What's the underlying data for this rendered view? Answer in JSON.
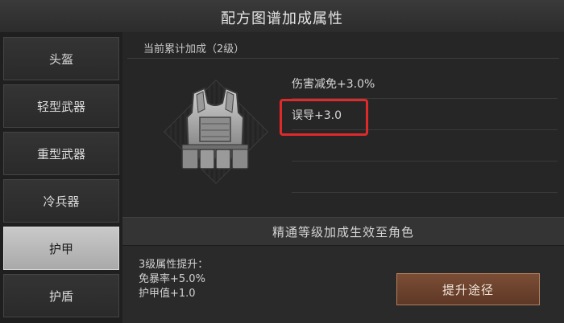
{
  "window": {
    "title": "配方图谱加成属性"
  },
  "sidebar": {
    "items": [
      {
        "label": "头盔"
      },
      {
        "label": "轻型武器"
      },
      {
        "label": "重型武器"
      },
      {
        "label": "冷兵器"
      },
      {
        "label": "护甲",
        "active": true
      },
      {
        "label": "护盾"
      }
    ]
  },
  "main": {
    "header": "当前累计加成（2级）",
    "item_icon": "armor-vest-icon",
    "stats": [
      {
        "label": "伤害减免+3.0%"
      },
      {
        "label": "误导+3.0"
      },
      {
        "label": ""
      },
      {
        "label": ""
      }
    ],
    "notice": "精通等级加成生效至角色",
    "next_level": {
      "title": "3级属性提升：",
      "lines": [
        "免暴率+5.0%",
        "护甲值+1.0"
      ]
    },
    "upgrade_button": "提升途径"
  },
  "colors": {
    "highlight": "#e02a2a",
    "button": "#6e4530",
    "active_tab": "#bdbdbd"
  }
}
